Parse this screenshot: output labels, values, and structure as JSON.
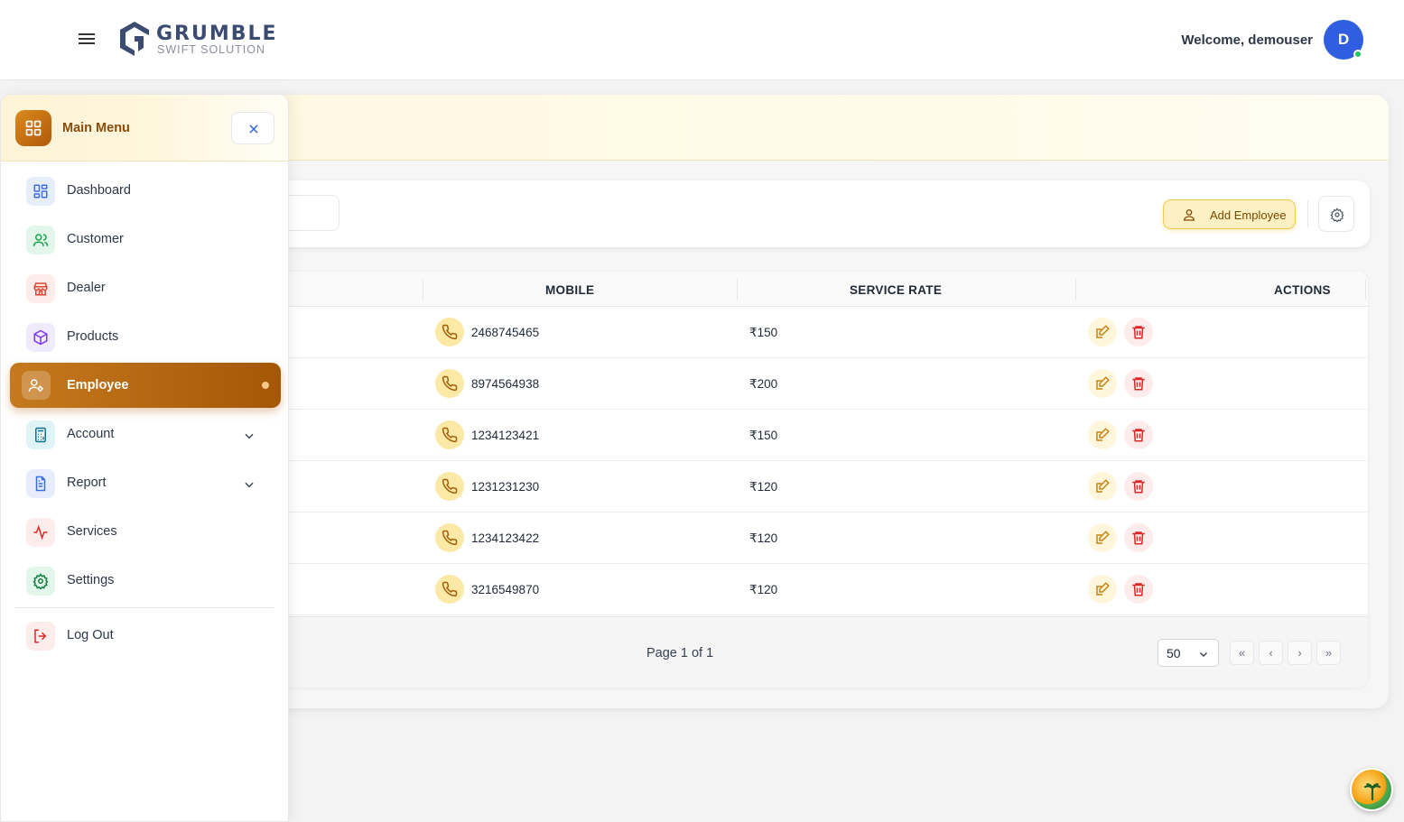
{
  "header": {
    "logo_title": "GRUMBLE",
    "logo_subtitle": "SWIFT SOLUTION",
    "welcome": "Welcome, demouser",
    "avatar_initial": "D"
  },
  "sidebar": {
    "title": "Main Menu",
    "items": [
      {
        "label": "Dashboard",
        "icon": "grid-icon"
      },
      {
        "label": "Customer",
        "icon": "users-icon"
      },
      {
        "label": "Dealer",
        "icon": "store-icon"
      },
      {
        "label": "Products",
        "icon": "box-icon"
      },
      {
        "label": "Employee",
        "icon": "user-cog-icon",
        "active": true
      },
      {
        "label": "Account",
        "icon": "calculator-icon",
        "expandable": true
      },
      {
        "label": "Report",
        "icon": "file-icon",
        "expandable": true
      },
      {
        "label": "Services",
        "icon": "activity-icon"
      },
      {
        "label": "Settings",
        "icon": "gear-icon"
      }
    ],
    "logout": "Log Out"
  },
  "toolbar": {
    "add_label": "Add Employee"
  },
  "table": {
    "columns": [
      "MOBILE",
      "SERVICE RATE",
      "ACTIONS"
    ],
    "rows": [
      {
        "mobile": "2468745465",
        "rate": "₹150"
      },
      {
        "mobile": "8974564938",
        "rate": "₹200"
      },
      {
        "mobile": "1234123421",
        "rate": "₹150"
      },
      {
        "mobile": "1231231230",
        "rate": "₹120"
      },
      {
        "mobile": "1234123422",
        "rate": "₹120"
      },
      {
        "mobile": "3216549870",
        "rate": "₹120"
      }
    ]
  },
  "pagination": {
    "page_info": "Page 1 of 1",
    "page_size": "50",
    "first": "«",
    "prev": "‹",
    "next": "›",
    "last": "»"
  },
  "colors": {
    "accent": "#b8650f",
    "brand": "#3c4b72",
    "avatar": "#2f5fe0"
  }
}
